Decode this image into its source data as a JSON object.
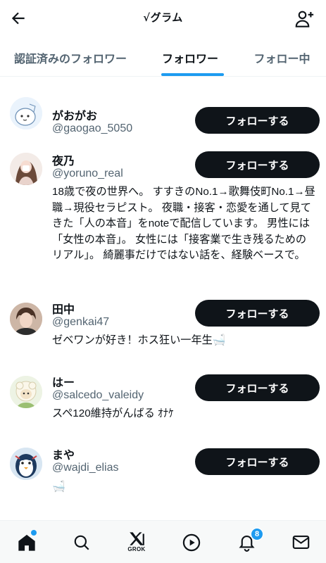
{
  "header": {
    "title": "√グラム",
    "back_icon": "arrow-left-icon",
    "add_user_icon": "person-add-icon"
  },
  "tabs": [
    {
      "label": "認証済みのフォロワー",
      "active": false
    },
    {
      "label": "フォロワー",
      "active": true
    },
    {
      "label": "フォロー中",
      "active": false
    }
  ],
  "users": [
    {
      "name": "がおがお",
      "handle": "@gaogao_5050",
      "bio": "",
      "follow_label": "フォローする",
      "avatar_icon": "cartoon-character-avatar"
    },
    {
      "name": "夜乃",
      "handle": "@yoruno_real",
      "bio": "18歳で夜の世界へ。 すすきのNo.1→歌舞伎町No.1→昼職→現役セラピスト。 夜職・接客・恋愛を通して見てきた「人の本音」をnoteで配信しています。 男性には「女性の本音」。 女性には「接客業で生き残るためのリアル」。 綺麗事だけではない話を、経験ベースで。",
      "follow_label": "フォローする",
      "avatar_icon": "woman-photo-avatar"
    },
    {
      "name": "田中",
      "handle": "@genkai47",
      "bio": "ゼベワンが好き！ホス狂い一年生🛁",
      "follow_label": "フォローする",
      "avatar_icon": "man-photo-avatar"
    },
    {
      "name": "はー",
      "handle": "@salcedo_valeidy",
      "bio": "スペ120維持がんばる ｵﾅｹ",
      "follow_label": "フォローする",
      "avatar_icon": "sheep-character-avatar"
    },
    {
      "name": "まや",
      "handle": "@wajdi_elias",
      "bio": "🛁",
      "follow_label": "フォローする",
      "avatar_icon": "penguin-character-avatar"
    }
  ],
  "bottom_nav": {
    "items": [
      {
        "name": "home",
        "icon": "home-icon",
        "active": true
      },
      {
        "name": "search",
        "icon": "search-icon",
        "active": false
      },
      {
        "name": "grok",
        "icon": "grok-icon",
        "label": "GROK",
        "active": false
      },
      {
        "name": "video",
        "icon": "play-icon",
        "active": false
      },
      {
        "name": "notifications",
        "icon": "bell-icon",
        "badge": "8",
        "active": false
      },
      {
        "name": "messages",
        "icon": "mail-icon",
        "active": false
      }
    ]
  },
  "colors": {
    "accent": "#1d9bf0",
    "text_primary": "#0f1419",
    "text_secondary": "#536471",
    "button_bg": "#0f1419",
    "divider": "#eff3f4"
  }
}
